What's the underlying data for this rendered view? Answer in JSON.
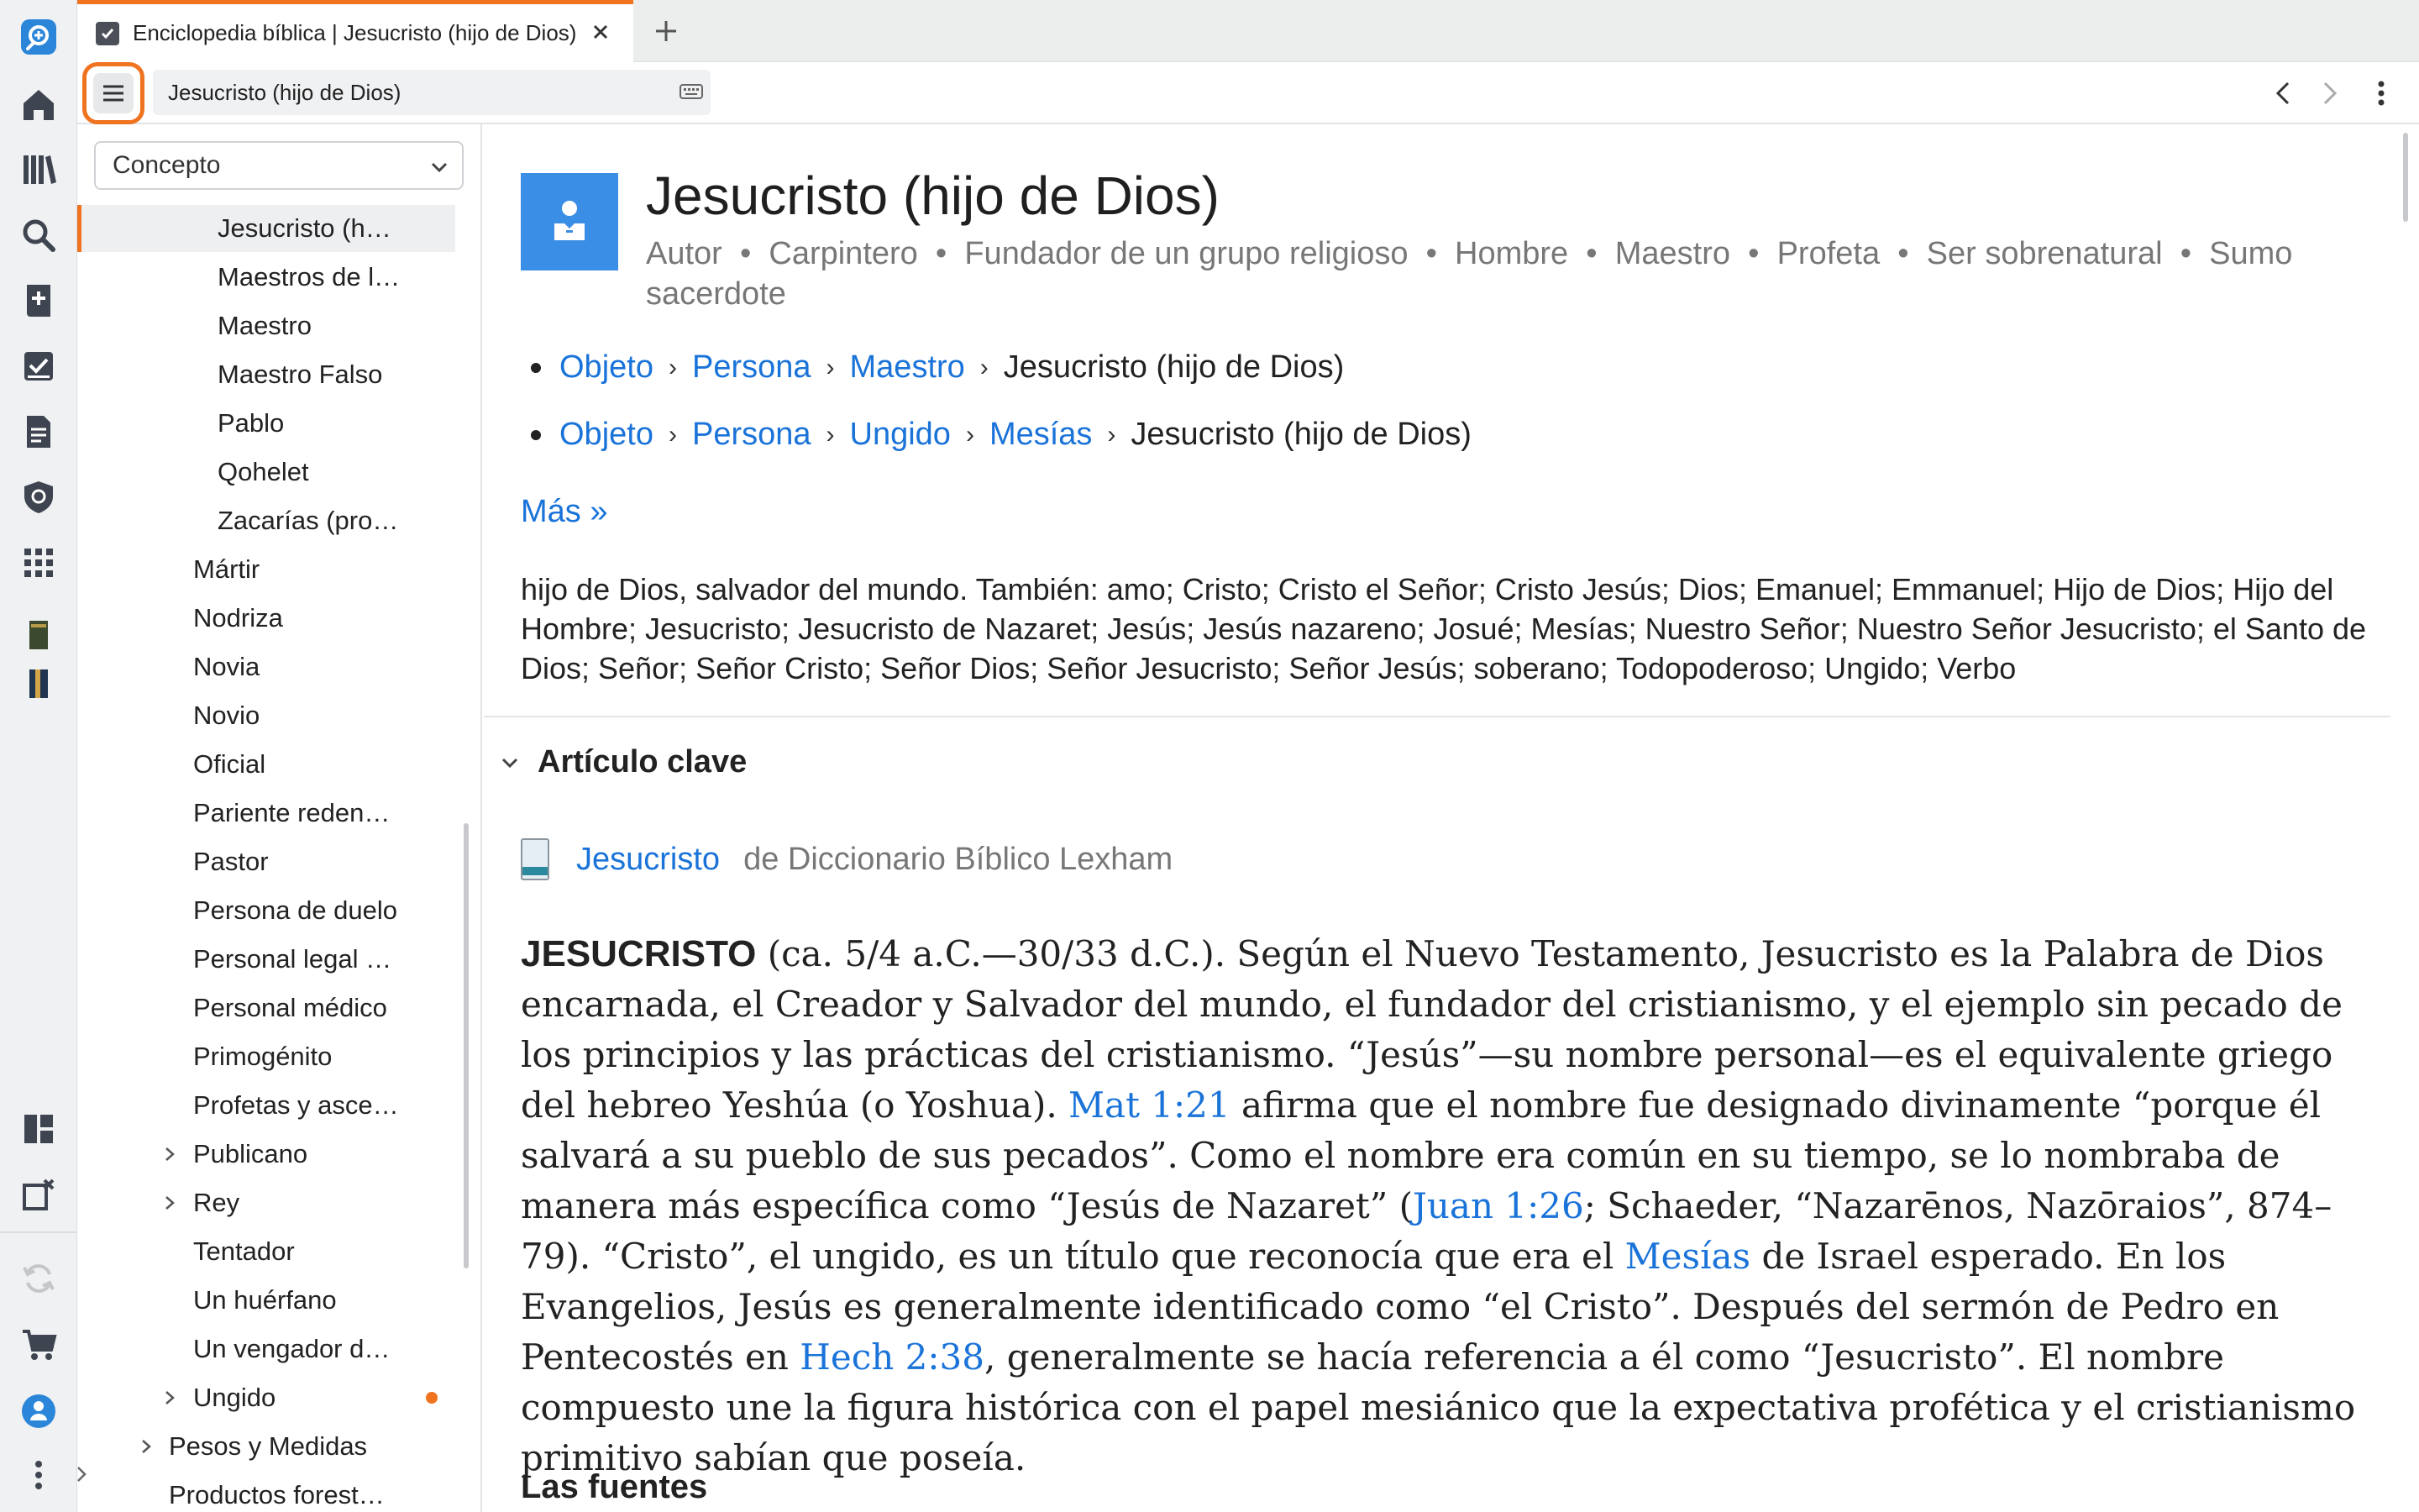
{
  "tab": {
    "title": "Enciclopedia bíblica | Jesucristo (hijo de Dios)"
  },
  "toolbar": {
    "address": "Jesucristo (hijo de Dios)"
  },
  "sidebar": {
    "selector_value": "Concepto",
    "items": [
      {
        "label": "Jesucristo (h…",
        "selected": true,
        "expandable": false
      },
      {
        "label": "Maestros de l…",
        "expandable": false
      },
      {
        "label": "Maestro",
        "expandable": false
      },
      {
        "label": "Maestro Falso",
        "expandable": false
      },
      {
        "label": "Pablo",
        "expandable": false
      },
      {
        "label": "Qohelet",
        "expandable": false
      },
      {
        "label": "Zacarías (pro…",
        "expandable": false
      },
      {
        "label": "Mártir",
        "expandable": false
      },
      {
        "label": "Nodriza",
        "expandable": false
      },
      {
        "label": "Novia",
        "expandable": false
      },
      {
        "label": "Novio",
        "expandable": false
      },
      {
        "label": "Oficial",
        "expandable": false
      },
      {
        "label": "Pariente reden…",
        "expandable": false
      },
      {
        "label": "Pastor",
        "expandable": false
      },
      {
        "label": "Persona de duelo",
        "expandable": false
      },
      {
        "label": "Personal legal …",
        "expandable": false
      },
      {
        "label": "Personal médico",
        "expandable": false
      },
      {
        "label": "Primogénito",
        "expandable": false
      },
      {
        "label": "Profetas y asce…",
        "expandable": false
      },
      {
        "label": "Publicano",
        "expandable": true
      },
      {
        "label": "Rey",
        "expandable": true
      },
      {
        "label": "Tentador",
        "expandable": false
      },
      {
        "label": "Un huérfano",
        "expandable": false
      },
      {
        "label": "Un vengador d…",
        "expandable": false
      },
      {
        "label": "Ungido",
        "expandable": true,
        "badge": true
      },
      {
        "label": "Pesos y Medidas",
        "expandable": true
      },
      {
        "label": "Productos forest…",
        "expandable": false
      }
    ]
  },
  "main": {
    "title": "Jesucristo (hijo de Dios)",
    "roles": [
      "Autor",
      "Carpintero",
      "Fundador de un grupo religioso",
      "Hombre",
      "Maestro",
      "Profeta",
      "Ser sobrenatural",
      "Sumo sacerdote"
    ],
    "breadcrumbs": [
      {
        "links": [
          "Objeto",
          "Persona",
          "Maestro"
        ],
        "current": "Jesucristo (hijo de Dios)"
      },
      {
        "links": [
          "Objeto",
          "Persona",
          "Ungido",
          "Mesías"
        ],
        "current": "Jesucristo (hijo de Dios)"
      }
    ],
    "more_label": "Más »",
    "aliases": "hijo de Dios, salvador del mundo. También: amo; Cristo; Cristo el Señor; Cristo Jesús; Dios; Emanuel; Emmanuel; Hijo de Dios; Hijo del Hombre; Jesucristo; Jesucristo de Nazaret; Jesús; Jesús nazareno; Josué; Mesías; Nuestro Señor; Nuestro Señor Jesucristo; el Santo de Dios; Señor; Señor Cristo; Señor Dios; Señor Jesucristo; Señor Jesús; soberano; Todopoderoso; Ungido; Verbo",
    "section_title": "Artículo clave",
    "source": {
      "link": "Jesucristo",
      "from": "de Diccionario Bíblico Lexham"
    },
    "article": {
      "lead": "JESUCRISTO",
      "t1": " (ca. 5/4 a.C.—30/33 d.C.). Según el Nuevo Testamento, Jesucristo es la Palabra de Dios encarnada, el Creador y Salvador del mundo, el fundador del cristianismo, y el ejemplo sin pecado de los principios y las prácticas del cristianismo. “Jesús”—su nombre personal—es el equivalente griego del hebreo Yeshúa (o Yoshua). ",
      "ref1": "Mat 1:21",
      "t2": " afirma que el nombre fue designado divinamente “porque él salvará a su pueblo de sus pecados”. Como el nombre era común en su tiempo, se lo nombraba de manera más específica como “Jesús de Nazaret” (",
      "ref2": "Juan 1:26",
      "t3": "; Schaeder, “Nazarēnos, Nazōraios”, 874–79). “Cristo”, el ungido, es un título que reconocía que era el ",
      "ref3": "Mesías",
      "t4": " de Israel esperado. En los Evangelios, Jesús es generalmente identificado como “el Cristo”. Después del sermón de Pedro en Pentecostés en ",
      "ref4": "Hech 2:38",
      "t5": ", generalmente se hacía referencia a él como “Jesucristo”. El nombre compuesto une la figura histórica con el papel mesiánico que la expectativa profética y el cristianismo primitivo sabían que poseía."
    },
    "subheading": "Las fuentes"
  },
  "colors": {
    "accent": "#f0731f",
    "link": "#1a73d9",
    "concept_icon": "#3a8ee6"
  },
  "rail_icons": [
    "logos-search-icon",
    "home-icon",
    "library-icon",
    "search-icon",
    "bible-add-icon",
    "checklist-icon",
    "document-icon",
    "shield-icon",
    "apps-grid-icon",
    "book-thumbnail-1",
    "book-thumbnail-2",
    "layout-icon",
    "close-panels-icon",
    "sync-icon",
    "cart-icon",
    "account-icon",
    "more-vertical-icon"
  ]
}
